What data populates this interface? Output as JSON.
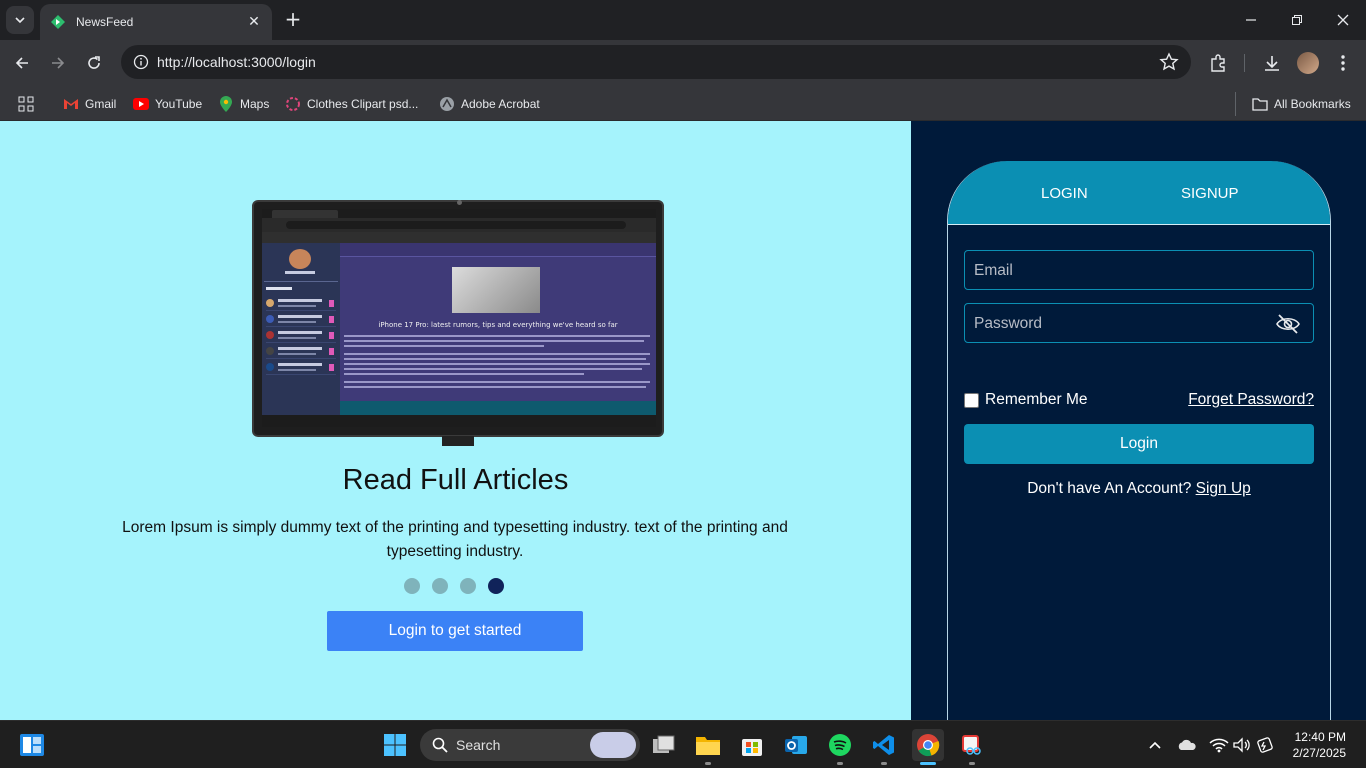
{
  "browser": {
    "tab_title": "NewsFeed",
    "url": "http://localhost:3000/login",
    "bookmarks": [
      {
        "label": "Gmail",
        "icon": "gmail-icon"
      },
      {
        "label": "YouTube",
        "icon": "youtube-icon"
      },
      {
        "label": "Maps",
        "icon": "maps-icon"
      },
      {
        "label": "Clothes Clipart psd...",
        "icon": "clipart-icon"
      },
      {
        "label": "Adobe Acrobat",
        "icon": "acrobat-icon"
      }
    ],
    "all_bookmarks": "All Bookmarks"
  },
  "hero": {
    "headline": "Read Full Articles",
    "description": "Lorem Ipsum is simply dummy text of the printing and typesetting industry. text of the printing and typesetting industry.",
    "carousel_dots": 4,
    "active_dot": 4,
    "cta_label": "Login to get started",
    "screenshot_article_title": "iPhone 17 Pro: latest rumors, tips and everything we've heard so far"
  },
  "auth": {
    "tabs": [
      "LOGIN",
      "SIGNUP"
    ],
    "email_placeholder": "Email",
    "password_placeholder": "Password",
    "remember_label": "Remember Me",
    "forget_label": "Forget Password?",
    "login_label": "Login",
    "no_account_text": "Don't have An Account?",
    "signup_link": "Sign Up"
  },
  "taskbar": {
    "search_label": "Search",
    "time": "12:40 PM",
    "date": "2/27/2025"
  },
  "colors": {
    "left_bg": "#a5f3fc",
    "right_bg": "#001a3a",
    "accent": "#0b8fb3",
    "cta": "#3b82f6",
    "active_dot": "#10235a"
  }
}
